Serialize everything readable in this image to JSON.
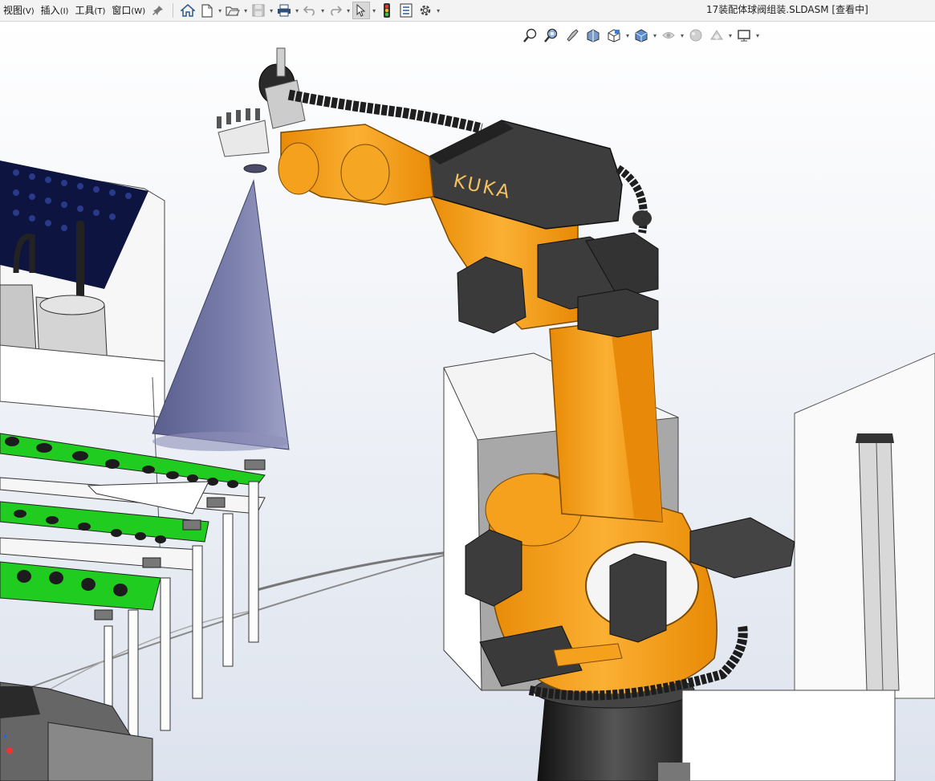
{
  "menu": {
    "items": [
      {
        "label": "视图",
        "key": "(V)"
      },
      {
        "label": "插入",
        "key": "(I)"
      },
      {
        "label": "工具",
        "key": "(T)"
      },
      {
        "label": "窗口",
        "key": "(W)"
      }
    ]
  },
  "toolbar": {
    "icons": [
      "pin-icon",
      "home-icon",
      "new-document-icon",
      "open-folder-icon",
      "save-icon",
      "print-icon",
      "undo-icon",
      "redo-icon",
      "select-arrow-icon",
      "traffic-light-icon",
      "file-properties-icon",
      "options-gear-icon"
    ]
  },
  "window": {
    "title": "17装配体球阀组装.SLDASM [查看中]"
  },
  "scene": {
    "robot_brand": "KUKA",
    "colors": {
      "robot_orange": "#f7a01b",
      "robot_dark": "#3c3c3c",
      "cone": "#6b6f9c",
      "green_fixture": "#1fcc1f",
      "background": "#ffffff"
    }
  }
}
